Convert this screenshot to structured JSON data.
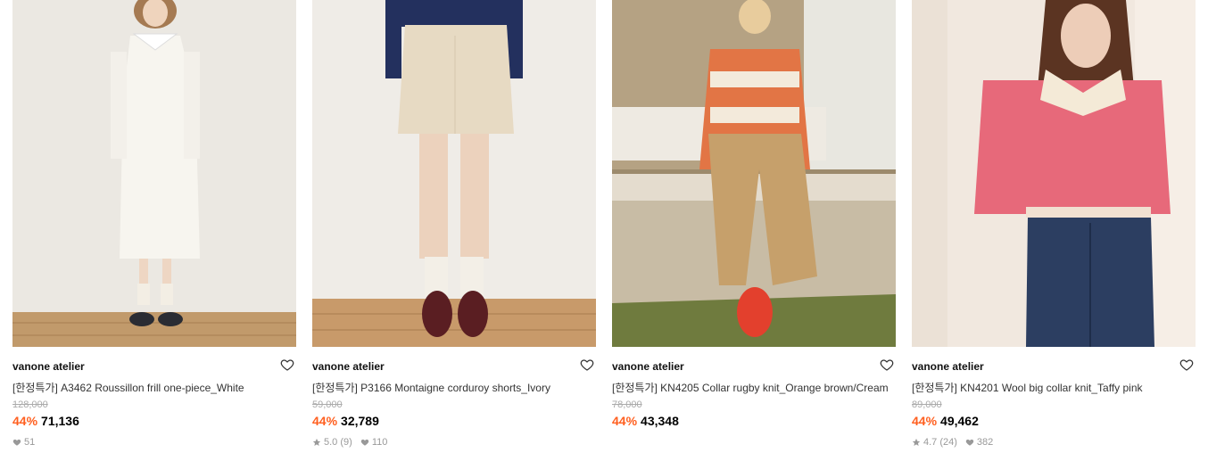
{
  "products": [
    {
      "brand": "vanone atelier",
      "title": "[한정특가] A3462 Roussillon frill one-piece_White",
      "original_price": "128,000",
      "discount": "44%",
      "price": "71,136",
      "rating": "",
      "review_count": "",
      "likes": "51",
      "image": "woman-white-long-dress"
    },
    {
      "brand": "vanone atelier",
      "title": "[한정특가] P3166 Montaigne corduroy shorts_Ivory",
      "original_price": "59,000",
      "discount": "44%",
      "price": "32,789",
      "rating": "5.0",
      "review_count": "(9)",
      "likes": "110",
      "image": "ivory-shorts-knee-socks"
    },
    {
      "brand": "vanone atelier",
      "title": "[한정특가] KN4205 Collar rugby knit_Orange brown/Cream",
      "original_price": "78,000",
      "discount": "44%",
      "price": "43,348",
      "rating": "",
      "review_count": "",
      "likes": "",
      "image": "woman-striped-knit-window"
    },
    {
      "brand": "vanone atelier",
      "title": "[한정특가] KN4201 Wool big collar knit_Taffy pink",
      "original_price": "89,000",
      "discount": "44%",
      "price": "49,462",
      "rating": "4.7",
      "review_count": "(24)",
      "likes": "382",
      "image": "woman-pink-knit-jeans"
    }
  ],
  "colors": {
    "discount": "#ff5f1f",
    "muted": "#999999",
    "strike": "#aaaaaa"
  }
}
